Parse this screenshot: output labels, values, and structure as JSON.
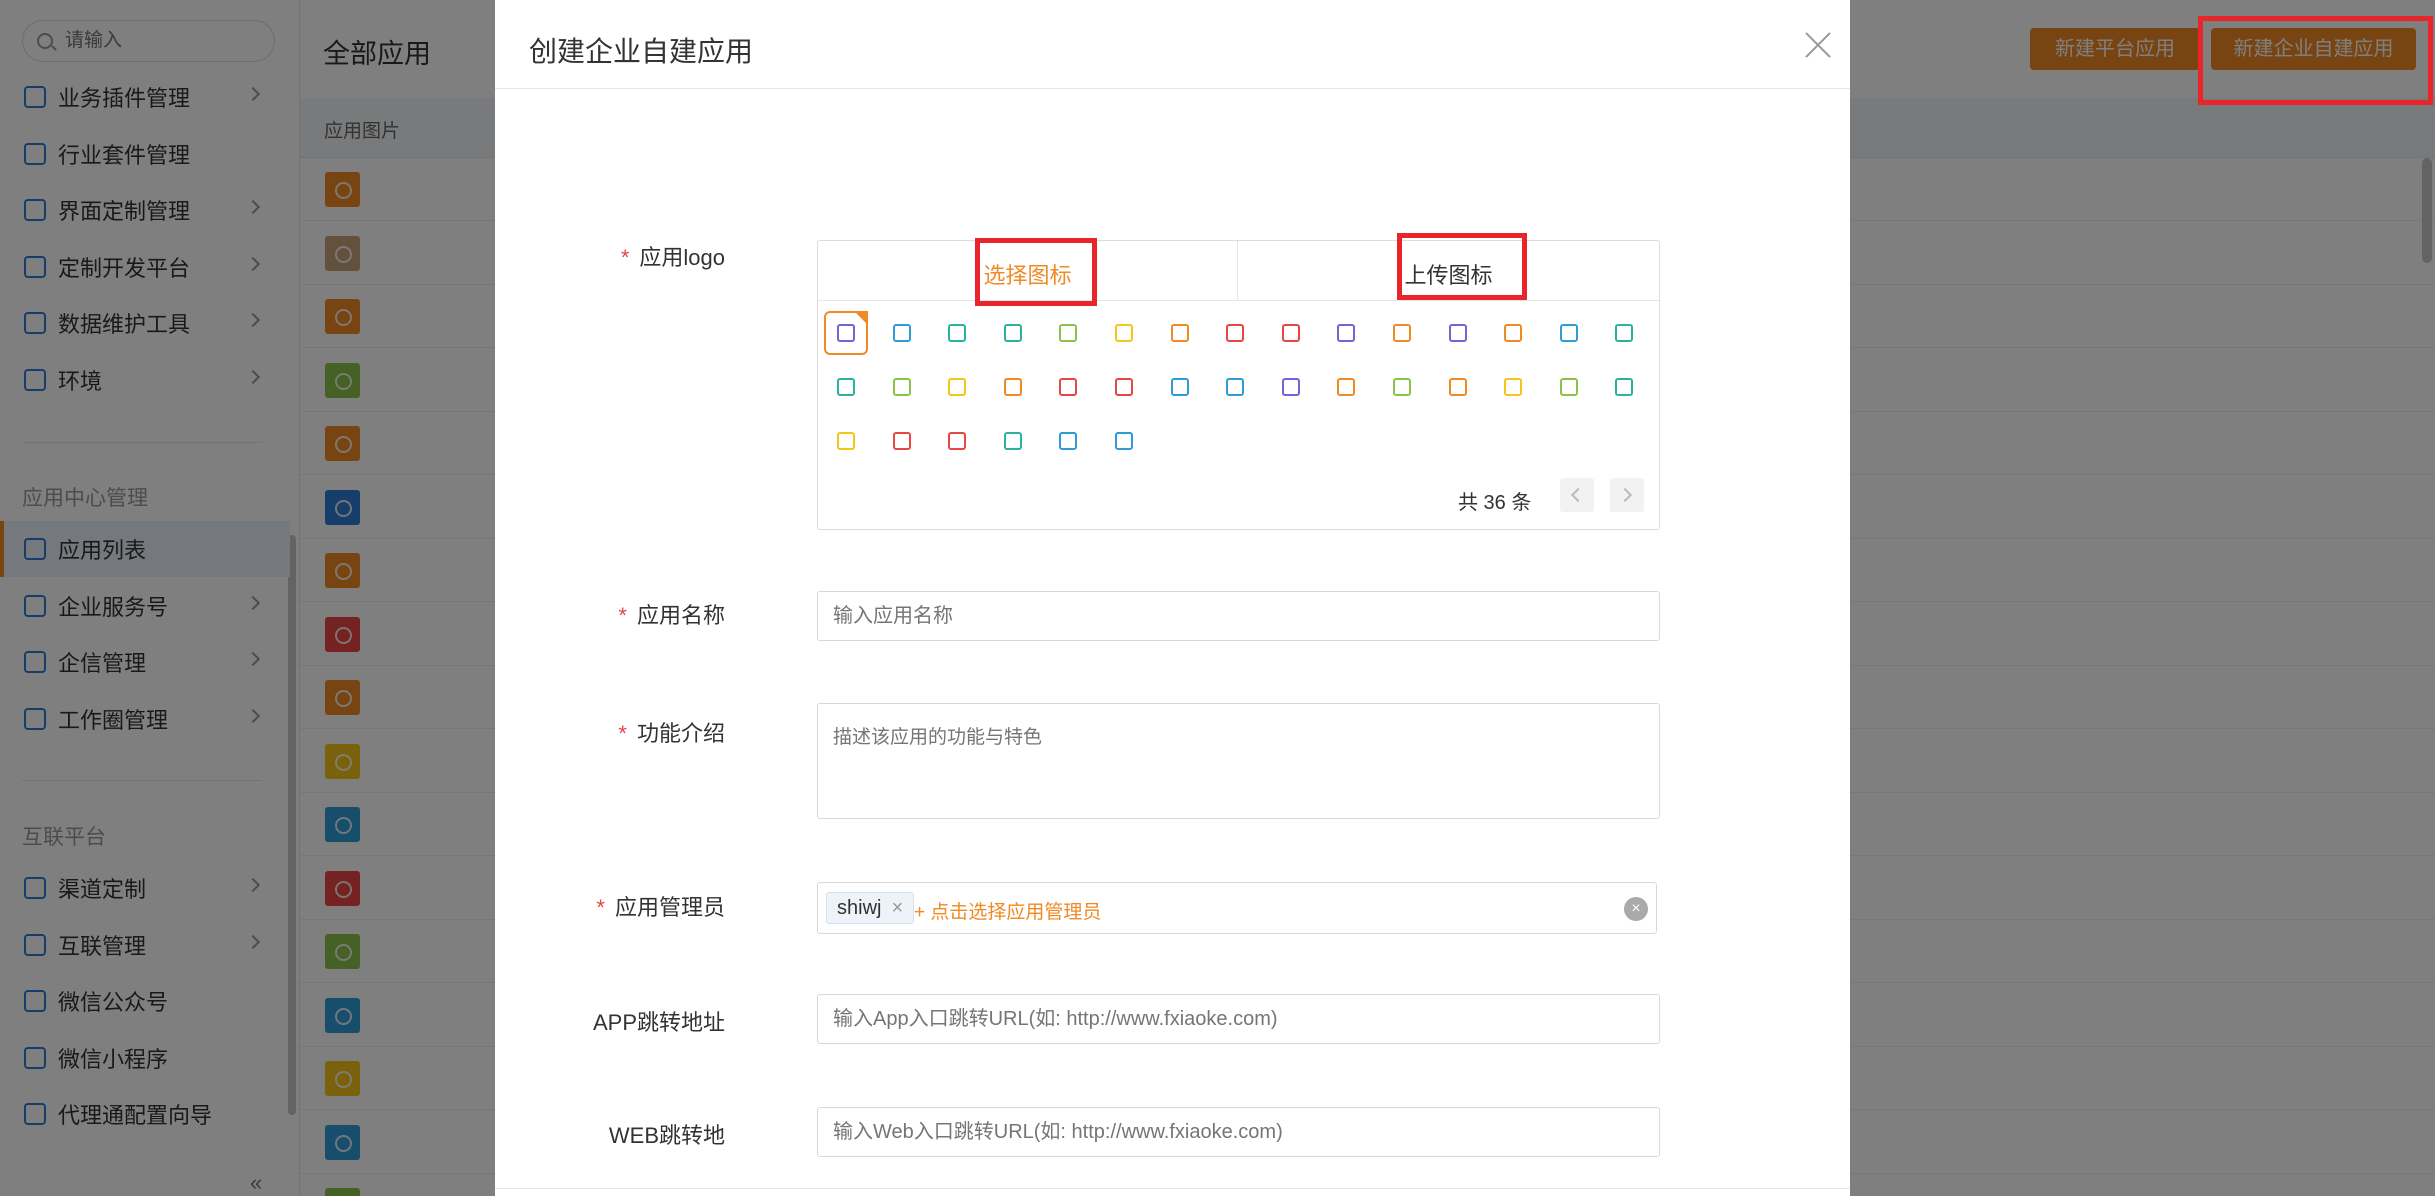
{
  "sidebar": {
    "search_placeholder": "请输入",
    "menu": [
      {
        "label": "业务插件管理",
        "icon": "puzzle-icon",
        "chevron": true
      },
      {
        "label": "行业套件管理",
        "icon": "suite-icon",
        "chevron": false
      },
      {
        "label": "界面定制管理",
        "icon": "layout-icon",
        "chevron": true
      },
      {
        "label": "定制开发平台",
        "icon": "code-icon",
        "chevron": true
      },
      {
        "label": "数据维护工具",
        "icon": "bar-chart-icon",
        "chevron": true
      },
      {
        "label": "环境",
        "icon": "environment-icon",
        "chevron": true
      }
    ],
    "section_app_center": "应用中心管理",
    "app_center_items": [
      {
        "label": "应用列表",
        "icon": "grid-icon",
        "chevron": false,
        "active": true
      },
      {
        "label": "企业服务号",
        "icon": "service-account-icon",
        "chevron": true
      },
      {
        "label": "企信管理",
        "icon": "chat-icon",
        "chevron": true
      },
      {
        "label": "工作圈管理",
        "icon": "compass-icon",
        "chevron": true
      }
    ],
    "section_interconnect": "互联平台",
    "interconnect_items": [
      {
        "label": "渠道定制",
        "icon": "channel-icon",
        "chevron": true
      },
      {
        "label": "互联管理",
        "icon": "link-rings-icon",
        "chevron": true
      },
      {
        "label": "微信公众号",
        "icon": "wechat-icon",
        "chevron": false
      },
      {
        "label": "微信小程序",
        "icon": "mini-program-icon",
        "chevron": false
      },
      {
        "label": "代理通配置向导",
        "icon": "agent-icon",
        "chevron": false
      }
    ],
    "collapse_glyph": "«"
  },
  "main": {
    "title": "全部应用",
    "new_platform_app": "新建平台应用",
    "new_enterprise_app": "新建企业自建应用",
    "table_header_image": "应用图片",
    "row_icon_colors": [
      "#f08a24",
      "#c9a37a",
      "#f08a24",
      "#8bc34a",
      "#f08a24",
      "#2e7bd6",
      "#f08a24",
      "#e84545",
      "#f08a24",
      "#f5c518",
      "#2e9cd6",
      "#e84545",
      "#8bc34a",
      "#2e9cd6",
      "#f5c518",
      "#2e9cd6",
      "#8bc34a"
    ]
  },
  "modal": {
    "title": "创建企业自建应用",
    "logo_label": "应用logo",
    "tab_select_icon": "选择图标",
    "tab_upload_icon": "上传图标",
    "icons": [
      {
        "name": "crosshair-icon",
        "color": "#7b5fd6"
      },
      {
        "name": "bar-chart-icon",
        "color": "#2e9cd6"
      },
      {
        "name": "stack-icon",
        "color": "#2bb29e"
      },
      {
        "name": "calendar-icon",
        "color": "#2bb29e"
      },
      {
        "name": "bag-icon",
        "color": "#8bc34a"
      },
      {
        "name": "shield-icon",
        "color": "#f5c518"
      },
      {
        "name": "presentation-icon",
        "color": "#f08a24"
      },
      {
        "name": "bookmark-icon",
        "color": "#e84545"
      },
      {
        "name": "window-icon",
        "color": "#e84545"
      },
      {
        "name": "globe-icon",
        "color": "#7b5fd6"
      },
      {
        "name": "target-icon",
        "color": "#f08a24"
      },
      {
        "name": "calendar-grid-icon",
        "color": "#7b5fd6"
      },
      {
        "name": "inbox-icon",
        "color": "#f08a24"
      },
      {
        "name": "archive-icon",
        "color": "#2e9cd6"
      },
      {
        "name": "pencil-icon",
        "color": "#2bb29e"
      },
      {
        "name": "checkbox-icon",
        "color": "#2bb29e"
      },
      {
        "name": "image-icon",
        "color": "#8bc34a"
      },
      {
        "name": "signpost-icon",
        "color": "#f5c518"
      },
      {
        "name": "lock-icon",
        "color": "#f08a24"
      },
      {
        "name": "buildings-icon",
        "color": "#e84545"
      },
      {
        "name": "clock-icon",
        "color": "#e84545"
      },
      {
        "name": "home-icon",
        "color": "#2e9cd6"
      },
      {
        "name": "card-icon",
        "color": "#2e9cd6"
      },
      {
        "name": "apps-icon",
        "color": "#7b5fd6"
      },
      {
        "name": "trash-icon",
        "color": "#f08a24"
      },
      {
        "name": "clipboard-icon",
        "color": "#8bc34a"
      },
      {
        "name": "diamond-icon",
        "color": "#f08a24"
      },
      {
        "name": "note-icon",
        "color": "#f5c518"
      },
      {
        "name": "folder-icon",
        "color": "#8bc34a"
      },
      {
        "name": "coins-icon",
        "color": "#2bb29e"
      },
      {
        "name": "building-icon",
        "color": "#f5c518"
      },
      {
        "name": "monitor-icon",
        "color": "#e84545"
      },
      {
        "name": "calendar-alt-icon",
        "color": "#e84545"
      },
      {
        "name": "house-icon",
        "color": "#2bb29e"
      },
      {
        "name": "save-icon",
        "color": "#2e9cd6"
      },
      {
        "name": "document-icon",
        "color": "#2e9cd6"
      }
    ],
    "selected_icon": 0,
    "pagination_total": "共 36 条",
    "name_label": "应用名称",
    "name_placeholder": "输入应用名称",
    "desc_label": "功能介绍",
    "desc_placeholder": "描述该应用的功能与特色",
    "admin_label": "应用管理员",
    "admin_tag": "shiwj",
    "admin_tag_remove": "×",
    "add_admin": "+ 点击选择应用管理员",
    "clear_glyph": "×",
    "app_url_label": "APP跳转地址",
    "app_url_placeholder": "输入App入口跳转URL(如: http://www.fxiaoke.com)",
    "web_url_label": "WEB跳转地",
    "web_url_placeholder": "输入Web入口跳转URL(如: http://www.fxiaoke.com)",
    "required_mark": "*"
  }
}
